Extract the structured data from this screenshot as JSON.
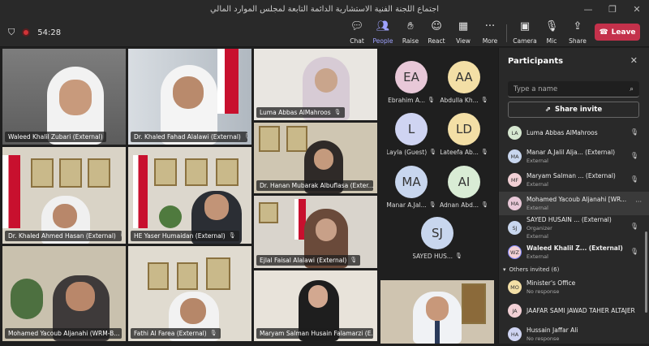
{
  "window": {
    "title": "اجتماع اللجنة الفنية الاستشارية الدائمة التابعة لمجلس الموارد المالي"
  },
  "toolbar": {
    "timer": "54:28",
    "buttons": {
      "chat": "Chat",
      "people": "People",
      "raise": "Raise",
      "react": "React",
      "view": "View",
      "more": "More",
      "camera": "Camera",
      "mic": "Mic",
      "share": "Share"
    },
    "leave": "Leave"
  },
  "video_tiles": [
    {
      "name": "Waleed Khalil Zubari (External)"
    },
    {
      "name": "Dr. Khaled Fahad Alalawi (External)"
    },
    {
      "name": "Luma Abbas AlMahroos"
    },
    {
      "name": "Dr. Hanan Mubarak Albuflasa (Exter..."
    },
    {
      "name": "Dr. Khaled Ahmed Hasan (External)"
    },
    {
      "name": "HE Yaser Humaidan (External)"
    },
    {
      "name": "Ejlal Faisal Alalawi (External)"
    },
    {
      "name": "Mohamed Yacoub Aljanahi (WRM-B..."
    },
    {
      "name": "Fathi Al Farea (External)"
    },
    {
      "name": "Maryam Salman Husain Falamarzi (E..."
    },
    {
      "name": ""
    }
  ],
  "avatar_tiles": [
    {
      "initials": "EA",
      "label": "Ebrahim A...",
      "color": "#e8c8d8"
    },
    {
      "initials": "AA",
      "label": "Abdulla Kh...",
      "color": "#f3dfa6"
    },
    {
      "initials": "L",
      "label": "Layla (Guest)",
      "color": "#cfd4f2"
    },
    {
      "initials": "LD",
      "label": "Lateefa Ab...",
      "color": "#f3dfa6"
    },
    {
      "initials": "MA",
      "label": "Manar A.Jal...",
      "color": "#c8d6ee"
    },
    {
      "initials": "AI",
      "label": "Adnan Abd...",
      "color": "#d9ecd5"
    },
    {
      "initials": "SJ",
      "label": "SAYED HUS...",
      "color": "#c8d6ee"
    }
  ],
  "participants_panel": {
    "title": "Participants",
    "search_placeholder": "Type a name",
    "share_invite": "Share invite",
    "participants": [
      {
        "initials": "LA",
        "name": "Luma Abbas AlMahroos",
        "sub": "",
        "color": "#d6e7d0"
      },
      {
        "initials": "MA",
        "name": "Manar A.Jalil Alja... (External)",
        "sub": "External",
        "color": "#c8d6ee"
      },
      {
        "initials": "MF",
        "name": "Maryam Salman ... (External)",
        "sub": "External",
        "color": "#f2d0d5"
      },
      {
        "initials": "MA",
        "name": "Mohamed Yacoub Aljanahi [WR...",
        "sub": "External",
        "color": "#e8c8d8"
      },
      {
        "initials": "SJ",
        "name": "SAYED HUSAIN ... (External)",
        "sub": "Organizer",
        "sub2": "External",
        "color": "#c8d6ee"
      },
      {
        "initials": "WZ",
        "name": "Waleed Khalil Z...",
        "name_suffix": "(External)",
        "sub": "External",
        "color": "#f2d0d5"
      }
    ],
    "others_header": "Others invited (6)",
    "others": [
      {
        "initials": "MO",
        "name": "Minister's Office",
        "sub": "No response",
        "color": "#f3dfa6"
      },
      {
        "initials": "JA",
        "name": "JAAFAR SAMI JAWAD TAHER ALTAJER",
        "sub": "",
        "color": "#f2d0d5"
      },
      {
        "initials": "HA",
        "name": "Hussain Jaffar Ali",
        "sub": "No response",
        "color": "#cfd4f2"
      }
    ]
  }
}
